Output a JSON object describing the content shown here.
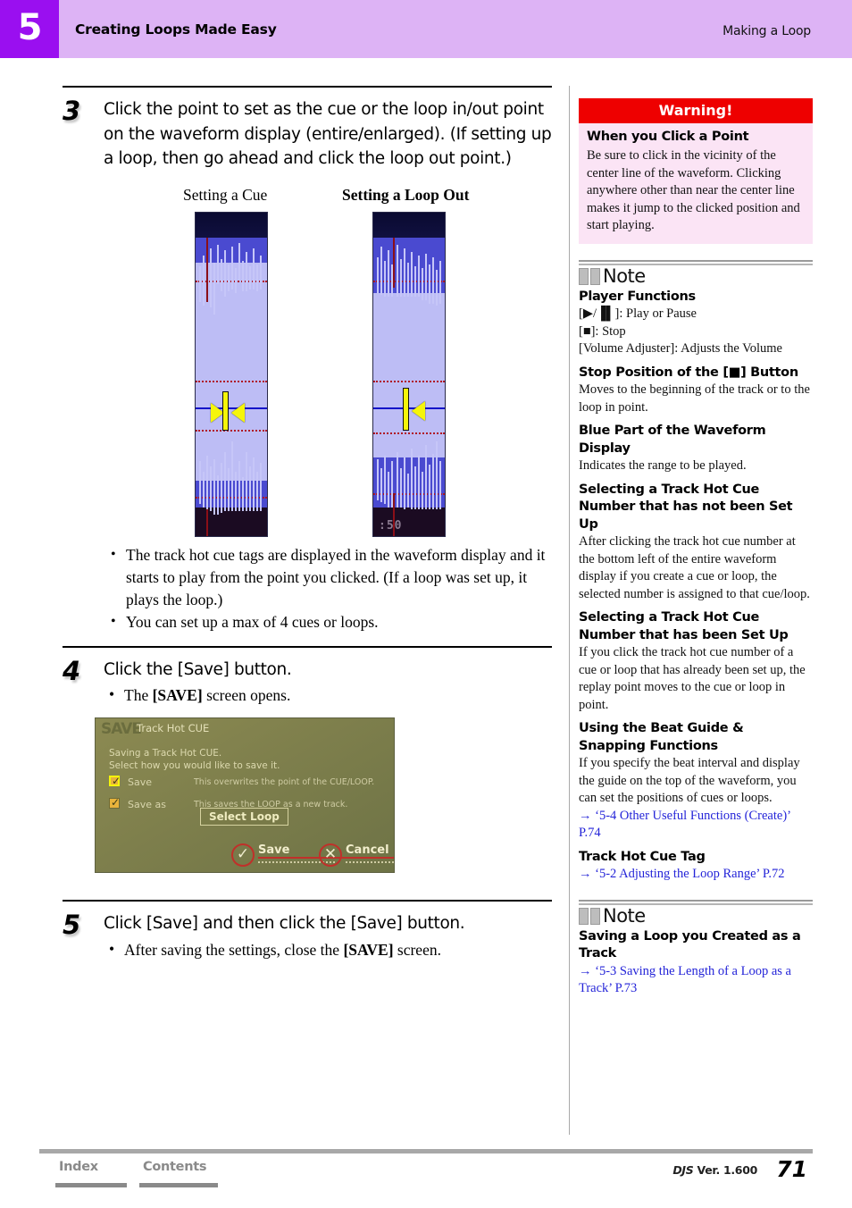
{
  "header": {
    "chapter_number": "5",
    "title": "Creating Loops Made Easy",
    "section": "Making a Loop"
  },
  "steps": [
    {
      "number": "3",
      "text": "Click the point to set as the cue or the loop in/out point on the waveform display (entire/enlarged). (If setting up a loop, then go ahead and click the loop out point.)"
    },
    {
      "number": "4",
      "text": "Click the [Save] button.",
      "sub_pre": "The ",
      "sub_bold": "[SAVE]",
      "sub_post": " screen opens."
    },
    {
      "number": "5",
      "text": "Click [Save] and then click the [Save] button.",
      "sub_pre": "After saving the settings, close the ",
      "sub_bold": "[SAVE]",
      "sub_post": " screen."
    }
  ],
  "figures": {
    "caption_left": "Setting a Cue",
    "caption_right": "Setting a Loop Out",
    "loop_out_time": ":50"
  },
  "step3_bullets": [
    "The track hot cue tags are displayed in the waveform display and it starts to play from the point you clicked. (If a loop was set up, it plays the loop.)",
    "You can set up a max of 4 cues or loops."
  ],
  "save_dialog": {
    "logo": "SAVE",
    "title": "Track Hot CUE",
    "description_line1": "Saving a Track Hot CUE.",
    "description_line2": "Select how you would like to save it.",
    "option1_label": "Save",
    "option1_note": "This overwrites the point of the CUE/LOOP.",
    "option2_label": "Save as",
    "option2_note": "This saves the LOOP as a new track.",
    "select_loop_button": "Select Loop",
    "save_button": "Save",
    "cancel_button": "Cancel"
  },
  "warning": {
    "header": "Warning!",
    "title": "When you Click a Point",
    "text": "Be sure to click in the vicinity of the center line of the waveform. Clicking anywhere other than near the center line makes it jump to the clicked position and start playing."
  },
  "note1": {
    "label": "Note",
    "blocks": [
      {
        "title": "Player Functions",
        "lines": [
          "[▶/▐▌]: Play or Pause",
          "[■]: Stop",
          "[Volume Adjuster]: Adjusts the Volume"
        ]
      },
      {
        "title": "Stop Position of the [■] Button",
        "text": "Moves to the beginning of the track or to the loop in point."
      },
      {
        "title": "Blue Part of the Waveform Display",
        "text": "Indicates the range to be played."
      },
      {
        "title": "Selecting a Track Hot Cue Number that has not been Set Up",
        "text": "After clicking the track hot cue number at the bottom left of the entire waveform display if you create a cue or loop, the selected number is assigned to that cue/loop."
      },
      {
        "title": "Selecting a Track Hot Cue Number that has been Set Up",
        "text": "If you click the track hot cue number of a cue or loop that has already been set up, the replay point moves to the cue or loop in point."
      },
      {
        "title": "Using the Beat Guide & Snapping Functions",
        "text": "If you specify the beat interval and display the guide on the top of the waveform, you can set the positions of cues or loops.",
        "link": "→ ‘5-4 Other Useful Functions (Create)’ P.74"
      },
      {
        "title": "Track Hot Cue Tag",
        "link": "→ ‘5-2 Adjusting the Loop Range’ P.72"
      }
    ]
  },
  "note2": {
    "label": "Note",
    "title": "Saving a Loop you Created as a Track",
    "link": "→ ‘5-3 Saving the Length of a Loop as a Track’ P.73"
  },
  "footer": {
    "index": "Index",
    "contents": "Contents",
    "version_brand": "DJS",
    "version_text": " Ver. 1.600",
    "page_number": "71"
  }
}
